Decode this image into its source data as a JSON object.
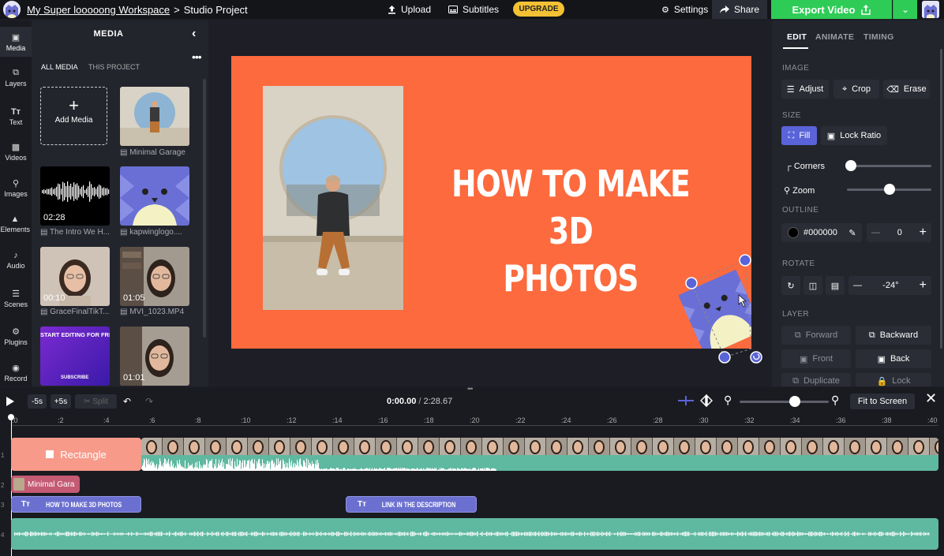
{
  "topbar": {
    "workspace": "My Super looooong Workspace",
    "separator": ">",
    "project": "Studio Project",
    "upload": "Upload",
    "subtitles": "Subtitles",
    "upgrade": "UPGRADE",
    "settings": "Settings",
    "share": "Share",
    "export": "Export Video"
  },
  "leftnav": [
    {
      "label": "Media",
      "icon": "plus-box-icon"
    },
    {
      "label": "Layers",
      "icon": "layers-icon"
    },
    {
      "label": "Text",
      "icon": "text-icon"
    },
    {
      "label": "Videos",
      "icon": "video-icon"
    },
    {
      "label": "Images",
      "icon": "search-icon"
    },
    {
      "label": "Elements",
      "icon": "shapes-icon"
    },
    {
      "label": "Audio",
      "icon": "music-note-icon"
    },
    {
      "label": "Scenes",
      "icon": "scenes-icon"
    },
    {
      "label": "Plugins",
      "icon": "plugin-icon"
    },
    {
      "label": "Record",
      "icon": "record-icon"
    }
  ],
  "media": {
    "title": "MEDIA",
    "tab_all": "ALL MEDIA",
    "tab_project": "THIS PROJECT",
    "add_media": "Add Media",
    "items": [
      {
        "label": "Minimal Garage",
        "duration": ""
      },
      {
        "label": "The Intro We H...",
        "duration": "02:28"
      },
      {
        "label": "kapwinglogo....",
        "duration": ""
      },
      {
        "label": "GraceFinalTikT...",
        "duration": "00:10"
      },
      {
        "label": "MVI_1023.MP4",
        "duration": "01:05"
      },
      {
        "label": "",
        "duration": "",
        "overlay_title": "START EDITING FOR FREE",
        "overlay_sub": "SUBSCRIBE"
      },
      {
        "label": "",
        "duration": "01:01"
      }
    ]
  },
  "canvas": {
    "headline_line1": "HOW TO MAKE 3D",
    "headline_line2": "PHOTOS",
    "background": "#fd6a3d"
  },
  "props": {
    "tabs": [
      "EDIT",
      "ANIMATE",
      "TIMING"
    ],
    "image_section": "IMAGE",
    "adjust": "Adjust",
    "crop": "Crop",
    "erase": "Erase",
    "size_section": "SIZE",
    "fill": "Fill",
    "lock_ratio": "Lock Ratio",
    "corners": "Corners",
    "corners_value": 0.05,
    "zoom": "Zoom",
    "zoom_value": 0.5,
    "outline_section": "OUTLINE",
    "outline_color": "#000000",
    "outline_width": "0",
    "rotate_section": "ROTATE",
    "rotate_value": "-24°",
    "layer_section": "LAYER",
    "forward": "Forward",
    "backward": "Backward",
    "front": "Front",
    "back": "Back",
    "duplicate": "Duplicate",
    "lock": "Lock"
  },
  "timeline": {
    "back5": "-5s",
    "fwd5": "+5s",
    "split": "Split",
    "current_time": "0:00.00",
    "total_time": "2:28.67",
    "fit": "Fit to Screen",
    "zoom_level": 0.62,
    "ruler": [
      ":0",
      ":2",
      ":4",
      ":6",
      ":8",
      ":10",
      ":12",
      ":14",
      ":16",
      ":18",
      ":20",
      ":22",
      ":24",
      ":26",
      ":28",
      ":30",
      ":32",
      ":34",
      ":36",
      ":38",
      ":40"
    ],
    "rows": [
      "1",
      "2",
      "3",
      "4"
    ],
    "clip_rectangle": "Rectangle",
    "clip_image": "Minimal Gara",
    "clip_text1": "HOW TO MAKE 3D PHOTOS",
    "clip_text2": "LINK IN THE DESCRIPTION"
  },
  "colors": {
    "accent_green": "#2ecc56",
    "upgrade_yellow": "#f3c134",
    "canvas_orange": "#fd6a3d",
    "selection_blue": "#5a64d8",
    "waveform_teal": "#5fb8a0"
  }
}
